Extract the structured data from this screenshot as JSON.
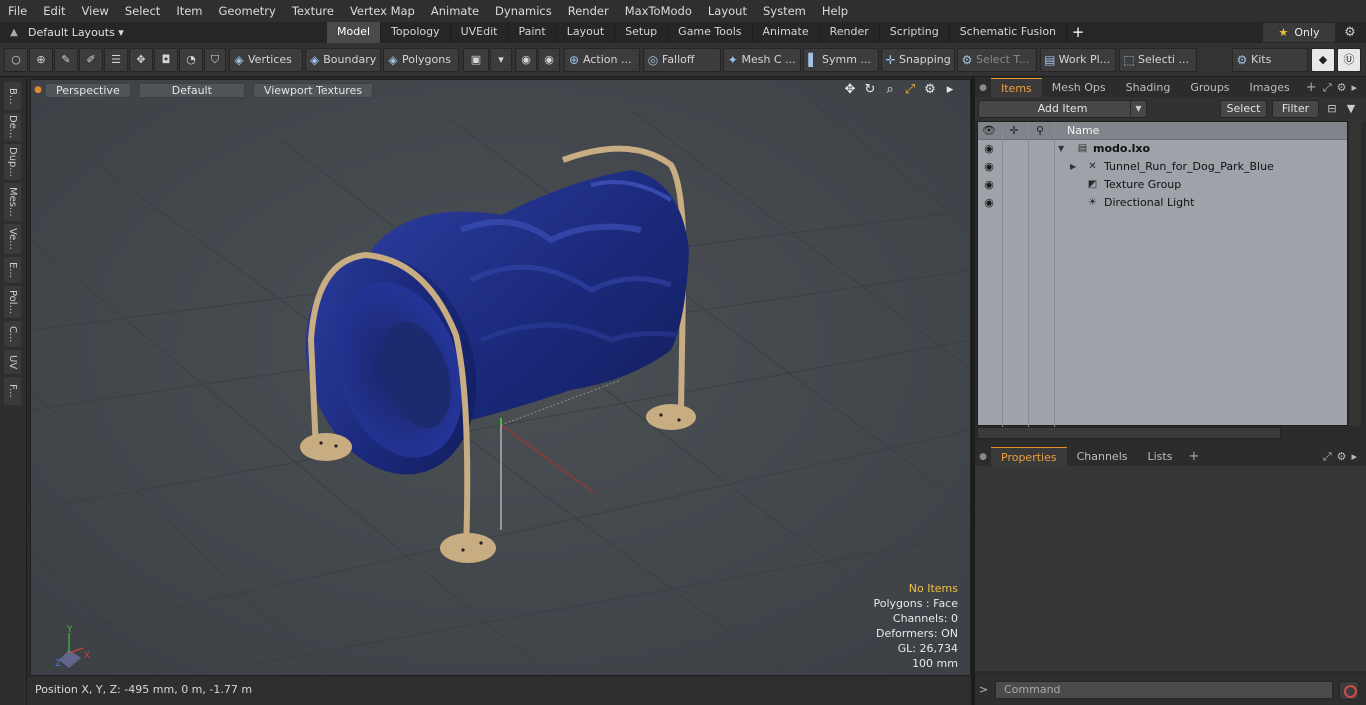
{
  "menu": [
    "File",
    "Edit",
    "View",
    "Select",
    "Item",
    "Geometry",
    "Texture",
    "Vertex Map",
    "Animate",
    "Dynamics",
    "Render",
    "MaxToModo",
    "Layout",
    "System",
    "Help"
  ],
  "layout_bar": {
    "layout_select": "Default Layouts ▾",
    "tabs": [
      "Model",
      "Topology",
      "UVEdit",
      "Paint",
      "Layout",
      "Setup",
      "Game Tools",
      "Animate",
      "Render",
      "Scripting",
      "Schematic Fusion"
    ],
    "active_tab": "Model",
    "only_label": "Only"
  },
  "toolbar": {
    "vertices": "Vertices",
    "boundary": "Boundary",
    "polygons": "Polygons",
    "action": "Action ...",
    "falloff": "Falloff",
    "mesh": "Mesh C ...",
    "symm": "Symm ...",
    "snapping": "Snapping",
    "select_t": "Select T...",
    "work_pl": "Work Pl...",
    "selecti": "Selecti ...",
    "kits": "Kits"
  },
  "left_tabs": [
    "B...",
    "De...",
    "Dup...",
    "Mes...",
    "Ve...",
    "E...",
    "Pol...",
    "C...",
    "UV",
    "F..."
  ],
  "viewport": {
    "view_mode": "Perspective",
    "shading": "Default",
    "textures": "Viewport Textures",
    "stats": {
      "items": "No Items",
      "polygons": "Polygons : Face",
      "channels": "Channels: 0",
      "deformers": "Deformers: ON",
      "gl": "GL: 26,734",
      "scale": "100 mm"
    },
    "axis_x": "X",
    "axis_y": "Y",
    "axis_z": "Z",
    "model_color": "#1c2b80",
    "frame_color": "#c8ac82"
  },
  "status": {
    "position": "Position X, Y, Z:   -495 mm, 0 m, -1.77 m"
  },
  "items_panel": {
    "tabs": [
      "Items",
      "Mesh Ops",
      "Shading",
      "Groups",
      "Images"
    ],
    "active_tab": "Items",
    "add_item": "Add Item",
    "select": "Select",
    "filter": "Filter",
    "name_header": "Name",
    "tree": [
      {
        "label": "modo.lxo",
        "icon": "scene-icon",
        "indent": 0,
        "bold": true
      },
      {
        "label": "Tunnel_Run_for_Dog_Park_Blue",
        "icon": "mesh-icon",
        "indent": 1,
        "bold": false
      },
      {
        "label": "Texture Group",
        "icon": "texture-icon",
        "indent": 1,
        "bold": false
      },
      {
        "label": "Directional Light",
        "icon": "light-icon",
        "indent": 1,
        "bold": false
      }
    ]
  },
  "props_panel": {
    "tabs": [
      "Properties",
      "Channels",
      "Lists"
    ],
    "active_tab": "Properties"
  },
  "command": {
    "prompt": ">",
    "placeholder": "Command"
  }
}
